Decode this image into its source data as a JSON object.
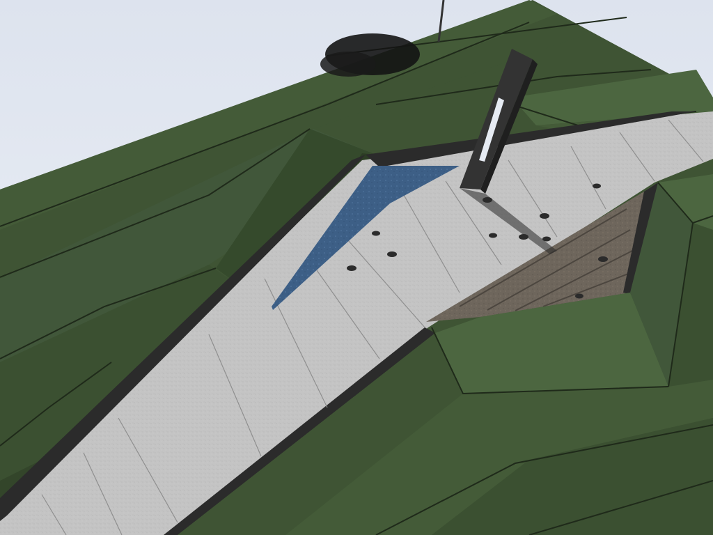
{
  "colors": {
    "sky_top": "#dde3ee",
    "sky_bottom": "#eef2f8",
    "grass": "#3f5434",
    "grass_light": "#4c6640",
    "grass_dark": "#33452a",
    "stripe": "#1f2a1a",
    "concrete": "#c4c4c4",
    "concrete_dark": "#a9a9a9",
    "stone_floor": "#6e665c",
    "water": "#3d5f86",
    "wall_dark": "#2b2b2b",
    "monument": "#333333",
    "tree": "#141414",
    "shadow": "#2a2a2a"
  }
}
